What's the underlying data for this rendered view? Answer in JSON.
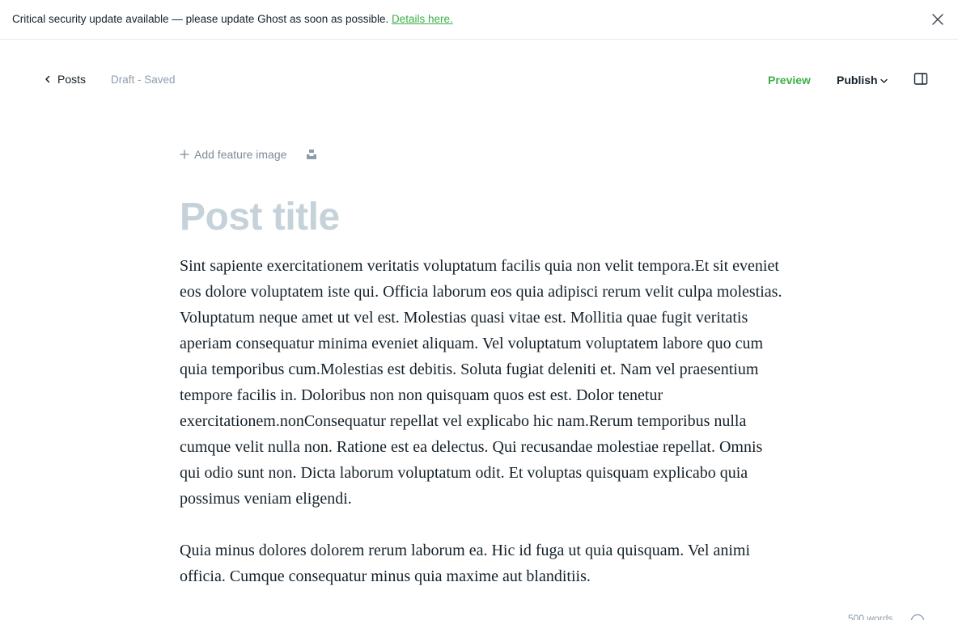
{
  "banner": {
    "message": "Critical security update available — please update Ghost as soon as possible. ",
    "link_label": "Details here."
  },
  "toolbar": {
    "back_label": "Posts",
    "status": "Draft - Saved",
    "preview_label": "Preview",
    "publish_label": "Publish"
  },
  "editor": {
    "add_feature_label": "Add feature image",
    "title_placeholder": "Post title",
    "paragraphs": [
      "Sint sapiente exercitationem veritatis voluptatum facilis quia non velit tempora.Et sit eveniet eos dolore voluptatem iste qui. Officia laborum eos quia adipisci rerum velit culpa molestias. Voluptatum neque amet ut vel est. Molestias quasi vitae est. Mollitia quae fugit veritatis aperiam consequatur minima eveniet aliquam. Vel voluptatum voluptatem labore quo cum quia temporibus cum.Molestias est debitis. Soluta fugiat deleniti et. Nam vel praesentium tempore facilis in. Doloribus non non quisquam quos est est. Dolor tenetur exercitationem.nonConsequatur repellat vel explicabo hic nam.Rerum temporibus nulla cumque velit nulla non. Ratione est ea delectus. Qui recusandae molestiae repellat. Omnis qui odio sunt non. Dicta laborum voluptatum odit. Et voluptas quisquam explicabo quia possimus veniam eligendi.",
      "Quia minus dolores dolorem rerum laborum ea. Hic id fuga ut quia quisquam. Vel animi officia. Cumque consequatur minus quia maxime aut blanditiis."
    ]
  },
  "footer": {
    "word_count": "500 words"
  },
  "icons": {
    "close": "close-icon",
    "back": "chevron-left-icon",
    "publish_dropdown": "chevron-down-icon",
    "sidebar": "sidebar-toggle-icon",
    "add": "plus-icon",
    "unsplash": "unsplash-icon",
    "help": "help-icon"
  },
  "colors": {
    "accent_green": "#3cb04a",
    "title_placeholder": "#c5d2d9",
    "muted_text": "#8e9cac"
  }
}
